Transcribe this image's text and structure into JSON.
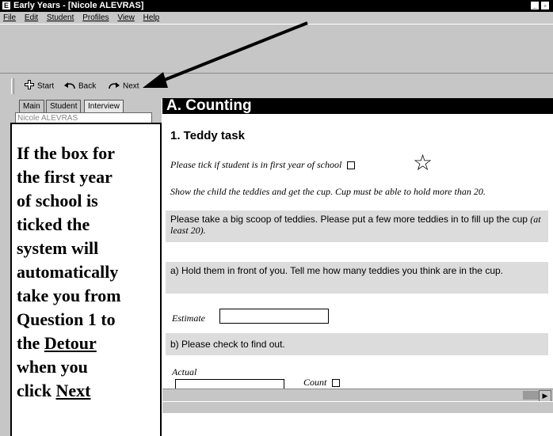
{
  "window": {
    "title": "Early Years - [Nicole ALEVRAS]",
    "app_icon": "E",
    "minimize": "_",
    "restore": "▫"
  },
  "menu": [
    "File",
    "Edit",
    "Student",
    "Profiles",
    "View",
    "Help"
  ],
  "toolbar": {
    "start_label": "Start",
    "back_label": "Back",
    "next_label": "Next"
  },
  "sidebar": {
    "tabs": [
      "Main",
      "Student",
      "Interview"
    ],
    "student_name": "Nicole ALEVRAS"
  },
  "callout": {
    "line1": "If the box for",
    "line2": "the first year",
    "line3": "of school is",
    "line4": "ticked the",
    "line5": "system will",
    "line6": "automatically",
    "line7": "take you from",
    "line8": "Question 1 to",
    "line9_pre": "the ",
    "line9_link": "Detour",
    "line10": "when you",
    "line11_pre": "click ",
    "line11_link": "Next"
  },
  "content": {
    "section_title": "A. Counting",
    "question_title": "1. Teddy task",
    "first_year_label": "Please tick if student is in first year of school",
    "star_icon": "☆",
    "instruction": "Show the child the teddies and get the cup. Cup must be able to hold more than 20.",
    "prompt1_main": "Please take a big scoop of teddies. Please put a few more teddies in to fill up the cup",
    "prompt1_note": "(at least 20).",
    "prompt2": "a) Hold them in front of you. Tell me how many teddies you think are in the cup.",
    "estimate_label": "Estimate",
    "prompt3": "b) Please check to find out.",
    "actual_label": "Actual",
    "count_label": "Count"
  }
}
